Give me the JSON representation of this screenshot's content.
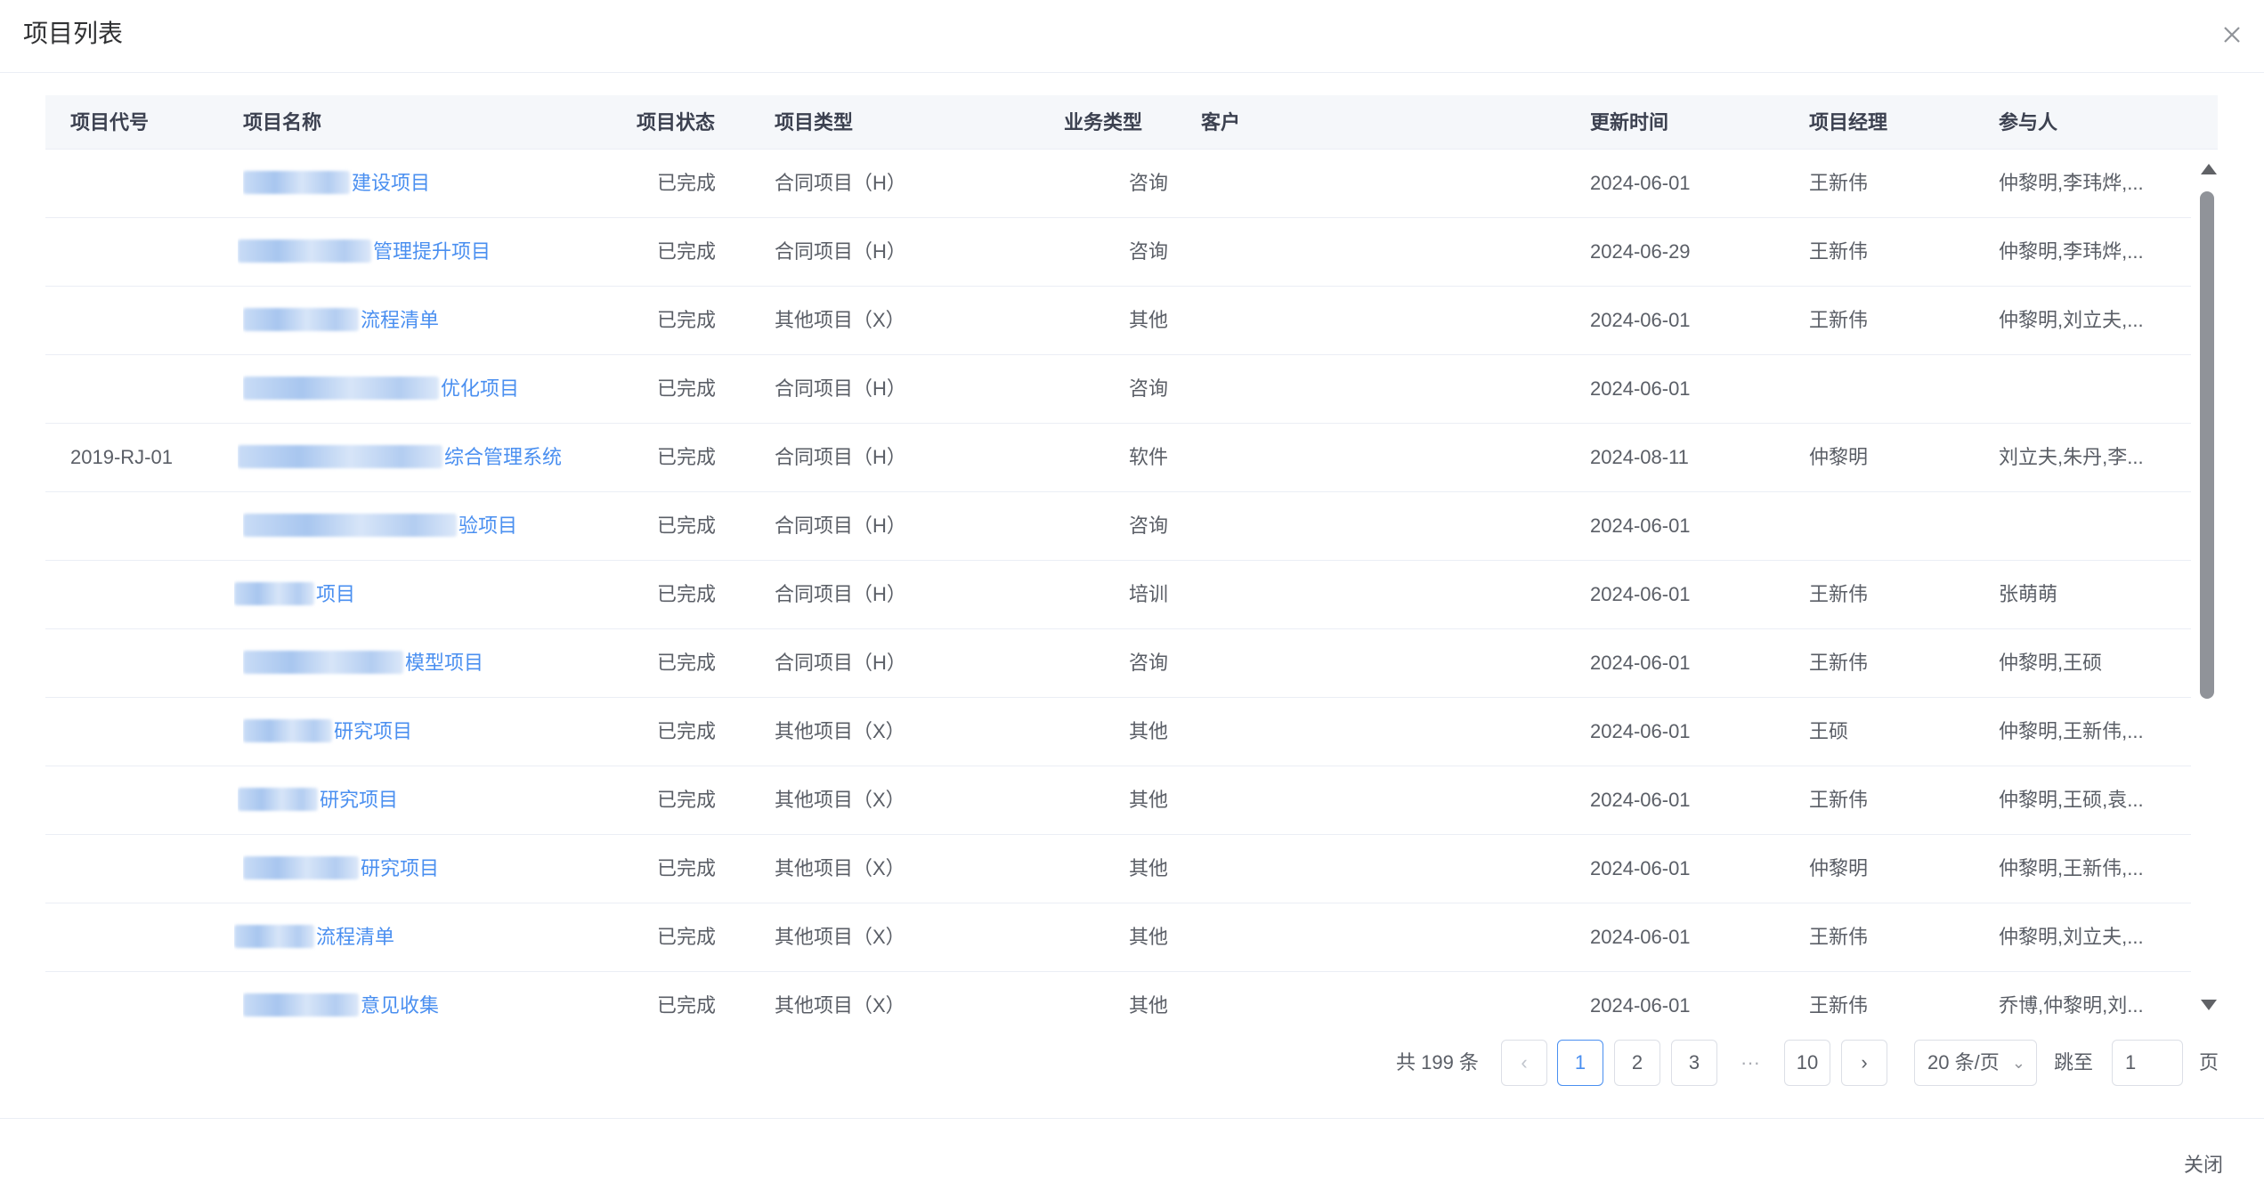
{
  "dialog": {
    "title": "项目列表",
    "close_label": "关闭"
  },
  "columns": [
    "项目代号",
    "项目名称",
    "项目状态",
    "项目类型",
    "业务类型",
    "客户",
    "更新时间",
    "项目经理",
    "参与人"
  ],
  "rows": [
    {
      "code": "",
      "name": "建设项目",
      "status": "已完成",
      "type": "合同项目（H）",
      "biz": "咨询",
      "customer": "",
      "updated": "2024-06-01",
      "manager": "王新伟",
      "members": "仲黎明,李玮烨,..."
    },
    {
      "code": "",
      "name": "管理提升项目",
      "status": "已完成",
      "type": "合同项目（H）",
      "biz": "咨询",
      "customer": "",
      "updated": "2024-06-29",
      "manager": "王新伟",
      "members": "仲黎明,李玮烨,..."
    },
    {
      "code": "",
      "name": "流程清单",
      "status": "已完成",
      "type": "其他项目（X）",
      "biz": "其他",
      "customer": "",
      "updated": "2024-06-01",
      "manager": "王新伟",
      "members": "仲黎明,刘立夫,..."
    },
    {
      "code": "",
      "name": "优化项目",
      "status": "已完成",
      "type": "合同项目（H）",
      "biz": "咨询",
      "customer": "",
      "updated": "2024-06-01",
      "manager": "",
      "members": ""
    },
    {
      "code": "2019-RJ-01",
      "name": "综合管理系统",
      "status": "已完成",
      "type": "合同项目（H）",
      "biz": "软件",
      "customer": "",
      "updated": "2024-08-11",
      "manager": "仲黎明",
      "members": "刘立夫,朱丹,李..."
    },
    {
      "code": "",
      "name": "验项目",
      "status": "已完成",
      "type": "合同项目（H）",
      "biz": "咨询",
      "customer": "",
      "updated": "2024-06-01",
      "manager": "",
      "members": ""
    },
    {
      "code": "",
      "name": "项目",
      "status": "已完成",
      "type": "合同项目（H）",
      "biz": "培训",
      "customer": "",
      "updated": "2024-06-01",
      "manager": "王新伟",
      "members": "张萌萌"
    },
    {
      "code": "",
      "name": "模型项目",
      "status": "已完成",
      "type": "合同项目（H）",
      "biz": "咨询",
      "customer": "",
      "updated": "2024-06-01",
      "manager": "王新伟",
      "members": "仲黎明,王硕"
    },
    {
      "code": "",
      "name": "研究项目",
      "status": "已完成",
      "type": "其他项目（X）",
      "biz": "其他",
      "customer": "",
      "updated": "2024-06-01",
      "manager": "王硕",
      "members": "仲黎明,王新伟,..."
    },
    {
      "code": "",
      "name": "研究项目",
      "status": "已完成",
      "type": "其他项目（X）",
      "biz": "其他",
      "customer": "",
      "updated": "2024-06-01",
      "manager": "王新伟",
      "members": "仲黎明,王硕,袁..."
    },
    {
      "code": "",
      "name": "研究项目",
      "status": "已完成",
      "type": "其他项目（X）",
      "biz": "其他",
      "customer": "",
      "updated": "2024-06-01",
      "manager": "仲黎明",
      "members": "仲黎明,王新伟,..."
    },
    {
      "code": "",
      "name": "流程清单",
      "status": "已完成",
      "type": "其他项目（X）",
      "biz": "其他",
      "customer": "",
      "updated": "2024-06-01",
      "manager": "王新伟",
      "members": "仲黎明,刘立夫,..."
    },
    {
      "code": "",
      "name": "意见收集",
      "status": "已完成",
      "type": "其他项目（X）",
      "biz": "其他",
      "customer": "",
      "updated": "2024-06-01",
      "manager": "王新伟",
      "members": "乔博,仲黎明,刘..."
    }
  ],
  "pagination": {
    "total_text": "共 199 条",
    "prev_icon": "chevron-left-icon",
    "next_icon": "chevron-right-icon",
    "pages": [
      "1",
      "2",
      "3",
      "10"
    ],
    "current": "1",
    "ellipsis": "···",
    "page_size": "20 条/页",
    "jump_label": "跳至",
    "jump_value": "1",
    "page_unit": "页"
  },
  "icons": {
    "close": "close-icon",
    "size_dropdown": "chevron-down-icon"
  }
}
